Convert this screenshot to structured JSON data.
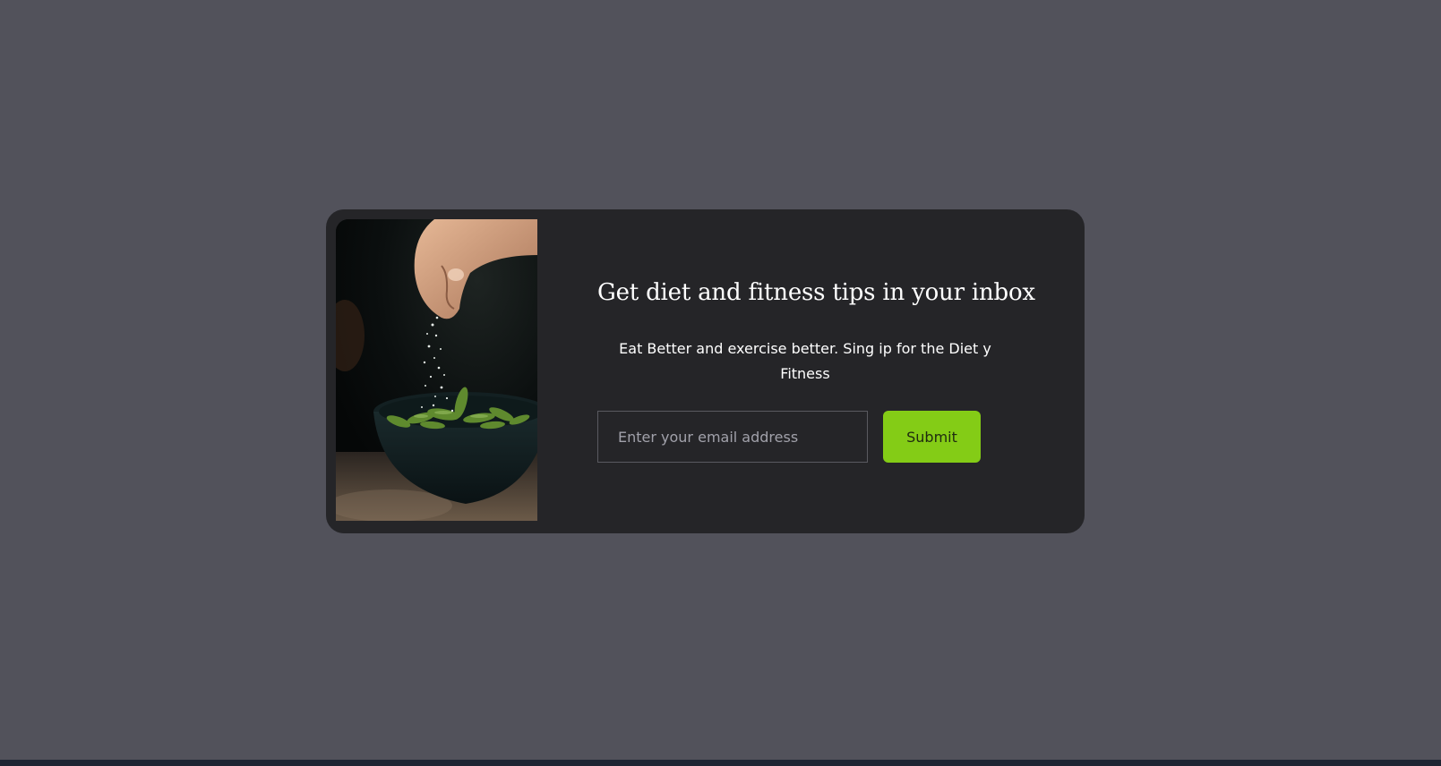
{
  "newsletter": {
    "title": "Get diet and fitness tips in your inbox",
    "description": "Eat Better and exercise better. Sing ip for the Diet y Fitness",
    "email_placeholder": "Enter your email address",
    "submit_label": "Submit"
  },
  "colors": {
    "page_background": "#52525b",
    "card_background": "#252528",
    "accent": "#84cc16",
    "text": "#ffffff"
  },
  "image": {
    "subject": "hand sprinkling salt over a bowl of edamame"
  }
}
